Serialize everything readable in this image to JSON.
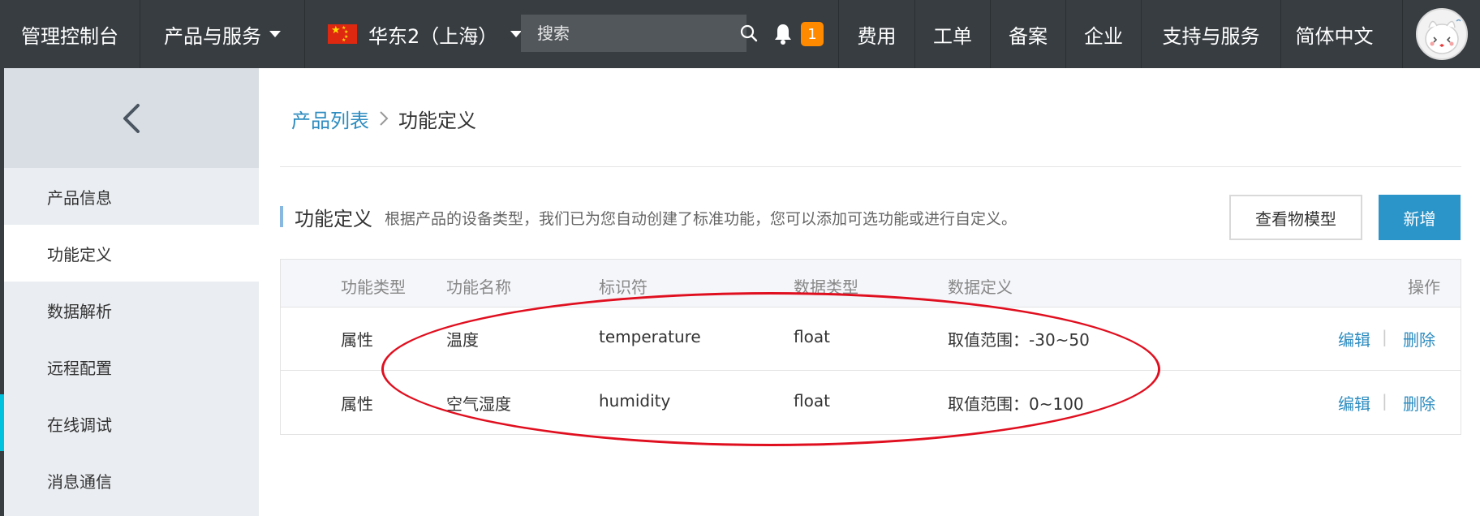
{
  "topbar": {
    "console": "管理控制台",
    "products": "产品与服务",
    "region": "华东2（上海）",
    "search_placeholder": "搜索",
    "notification_count": "1",
    "menu": [
      "费用",
      "工单",
      "备案",
      "企业",
      "支持与服务",
      "简体中文"
    ]
  },
  "sidebar": {
    "items": [
      {
        "label": "产品信息"
      },
      {
        "label": "功能定义"
      },
      {
        "label": "数据解析"
      },
      {
        "label": "远程配置"
      },
      {
        "label": "在线调试"
      },
      {
        "label": "消息通信"
      }
    ],
    "active_index": 1
  },
  "breadcrumb": {
    "link": "产品列表",
    "current": "功能定义"
  },
  "section": {
    "title": "功能定义",
    "description": "根据产品的设备类型，我们已为您自动创建了标准功能，您可以添加可选功能或进行自定义。",
    "view_model_button": "查看物模型",
    "add_button": "新增"
  },
  "table": {
    "headers": [
      "功能类型",
      "功能名称",
      "标识符",
      "数据类型",
      "数据定义",
      "操作"
    ],
    "rows": [
      {
        "type": "属性",
        "name": "温度",
        "identifier": "temperature",
        "data_type": "float",
        "definition": "取值范围：-30~50",
        "edit": "编辑",
        "delete": "删除"
      },
      {
        "type": "属性",
        "name": "空气湿度",
        "identifier": "humidity",
        "data_type": "float",
        "definition": "取值范围：0~100",
        "edit": "编辑",
        "delete": "删除"
      }
    ]
  },
  "colors": {
    "topbar": "#373d41",
    "accent": "#00c1de",
    "primary_button": "#2b94c9",
    "link": "#2d8cc0",
    "annotation": "#e00f1f"
  }
}
